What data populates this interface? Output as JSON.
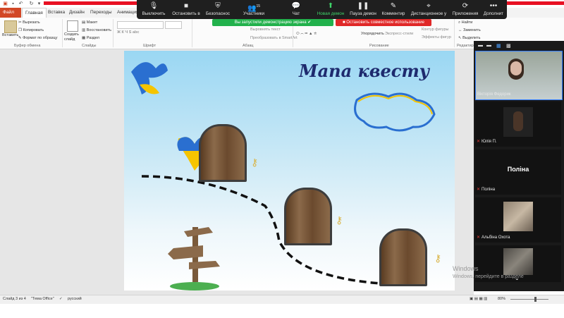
{
  "ribbon_tabs": [
    "Файл",
    "Главная",
    "Вставка",
    "Дизайн",
    "Переходы",
    "Анимация"
  ],
  "clipboard": {
    "paste": "Вставить",
    "cut": "Вырезать",
    "copy": "Копировать",
    "format": "Формат по образцу",
    "group": "Буфер обмена"
  },
  "slides_group": {
    "create": "Создать слайд",
    "layout": "Макет",
    "restore": "Восстановить",
    "section": "Раздел",
    "group": "Слайды"
  },
  "font_group": {
    "group": "Шрифт"
  },
  "paragraph_group": {
    "align_text": "Выровнять текст",
    "smartart": "Преобразовать в SmartArt",
    "group": "Абзац"
  },
  "drawing_group": {
    "arrange": "Упорядочить",
    "express": "Экспресс-стили",
    "fill": "Заливка фигуры",
    "outline": "Контур фигуры",
    "effects": "Эффекты фигур",
    "group": "Рисование"
  },
  "editing_group": {
    "find": "Найти",
    "replace": "Заменить",
    "select": "Выделить",
    "group": "Редактир..."
  },
  "zoom_toolbar": [
    {
      "label": "Выключить",
      "icon": "microphone-icon"
    },
    {
      "label": "Остановить в",
      "icon": "video-camera-icon"
    },
    {
      "label": "Безопаснос",
      "icon": "shield-icon"
    },
    {
      "label": "Участники",
      "icon": "participants-icon",
      "count": "15"
    },
    {
      "label": "Чат",
      "icon": "chat-icon"
    },
    {
      "label": "Новая демон",
      "icon": "share-screen-icon"
    },
    {
      "label": "Пауза демон",
      "icon": "pause-icon"
    },
    {
      "label": "Комментир",
      "icon": "pen-icon"
    },
    {
      "label": "Дистанционное у",
      "icon": "remote-control-icon"
    },
    {
      "label": "Приложения",
      "icon": "apps-icon"
    },
    {
      "label": "Дополнит",
      "icon": "more-icon"
    }
  ],
  "share_banner": {
    "text": "Вы запустили демонстрацию экрана",
    "stop": "Остановить совместное использование"
  },
  "slide": {
    "title": "Мапа квесту"
  },
  "participants": [
    {
      "name": "Вікторія Федорик",
      "type": "video"
    },
    {
      "name": "Юлія П.",
      "type": "photo"
    },
    {
      "name": "Поліна",
      "type": "name_only",
      "display": "Поліна"
    },
    {
      "name": "Альбіна Охота",
      "type": "photo"
    },
    {
      "name": "",
      "type": "photo"
    }
  ],
  "status": {
    "slide": "Слайд 3 из 4",
    "theme": "\"Тема Office\"",
    "language": "русский",
    "zoom": "80%"
  },
  "watermark": {
    "line1": "Windows",
    "line2": "Windows, перейдите в разделе"
  },
  "colors": {
    "file_tab": "#d24726",
    "share_green": "#22b14c",
    "stop_red": "#e02828",
    "zoom_bg": "#1f1f1f",
    "title_blue": "#1e2a6e"
  }
}
